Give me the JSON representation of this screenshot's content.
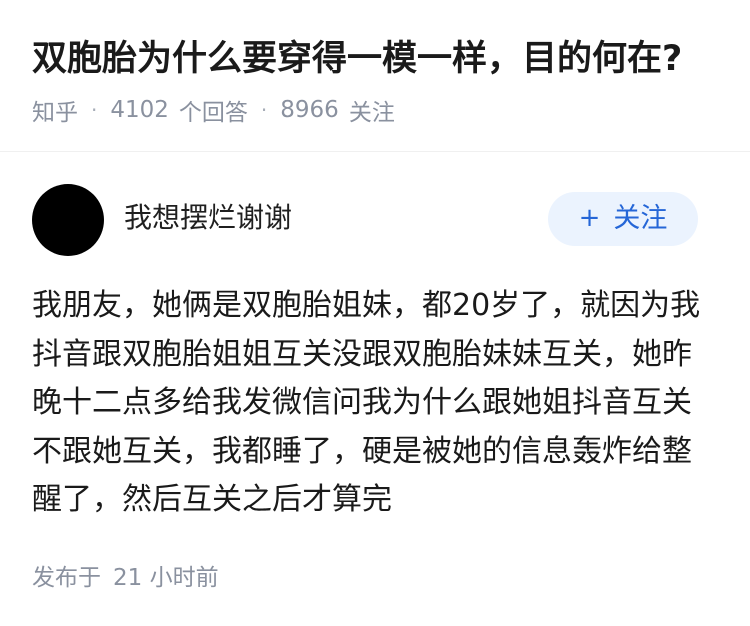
{
  "question": {
    "title": "双胞胎为什么要穿得一模一样，目的何在?",
    "source": "知乎",
    "answer_count": "4102",
    "answer_label": "个回答",
    "follower_count": "8966",
    "follower_label": "关注",
    "separator": "·"
  },
  "answer": {
    "author": {
      "name": "我想摆烂谢谢",
      "avatar_color": "#000000"
    },
    "follow_button": {
      "icon": "plus-icon",
      "icon_text": "+",
      "label": "关注",
      "accent_color": "#2566d7",
      "background_color": "#ebf3fe"
    },
    "content_lines": [
      "我朋友，她俩是双胞胎姐妹，都20岁了，就因为我",
      "抖音跟双胞胎姐姐互关没跟双胞胎妹妹互关，她昨",
      "晚十二点多给我发微信问我为什么跟她姐抖音互关",
      "不跟她互关，我都睡了，硬是被她的信息轰炸给整",
      "醒了，然后互关之后才算完"
    ],
    "published": {
      "prefix": "发布于",
      "time": "21 小时前"
    }
  }
}
